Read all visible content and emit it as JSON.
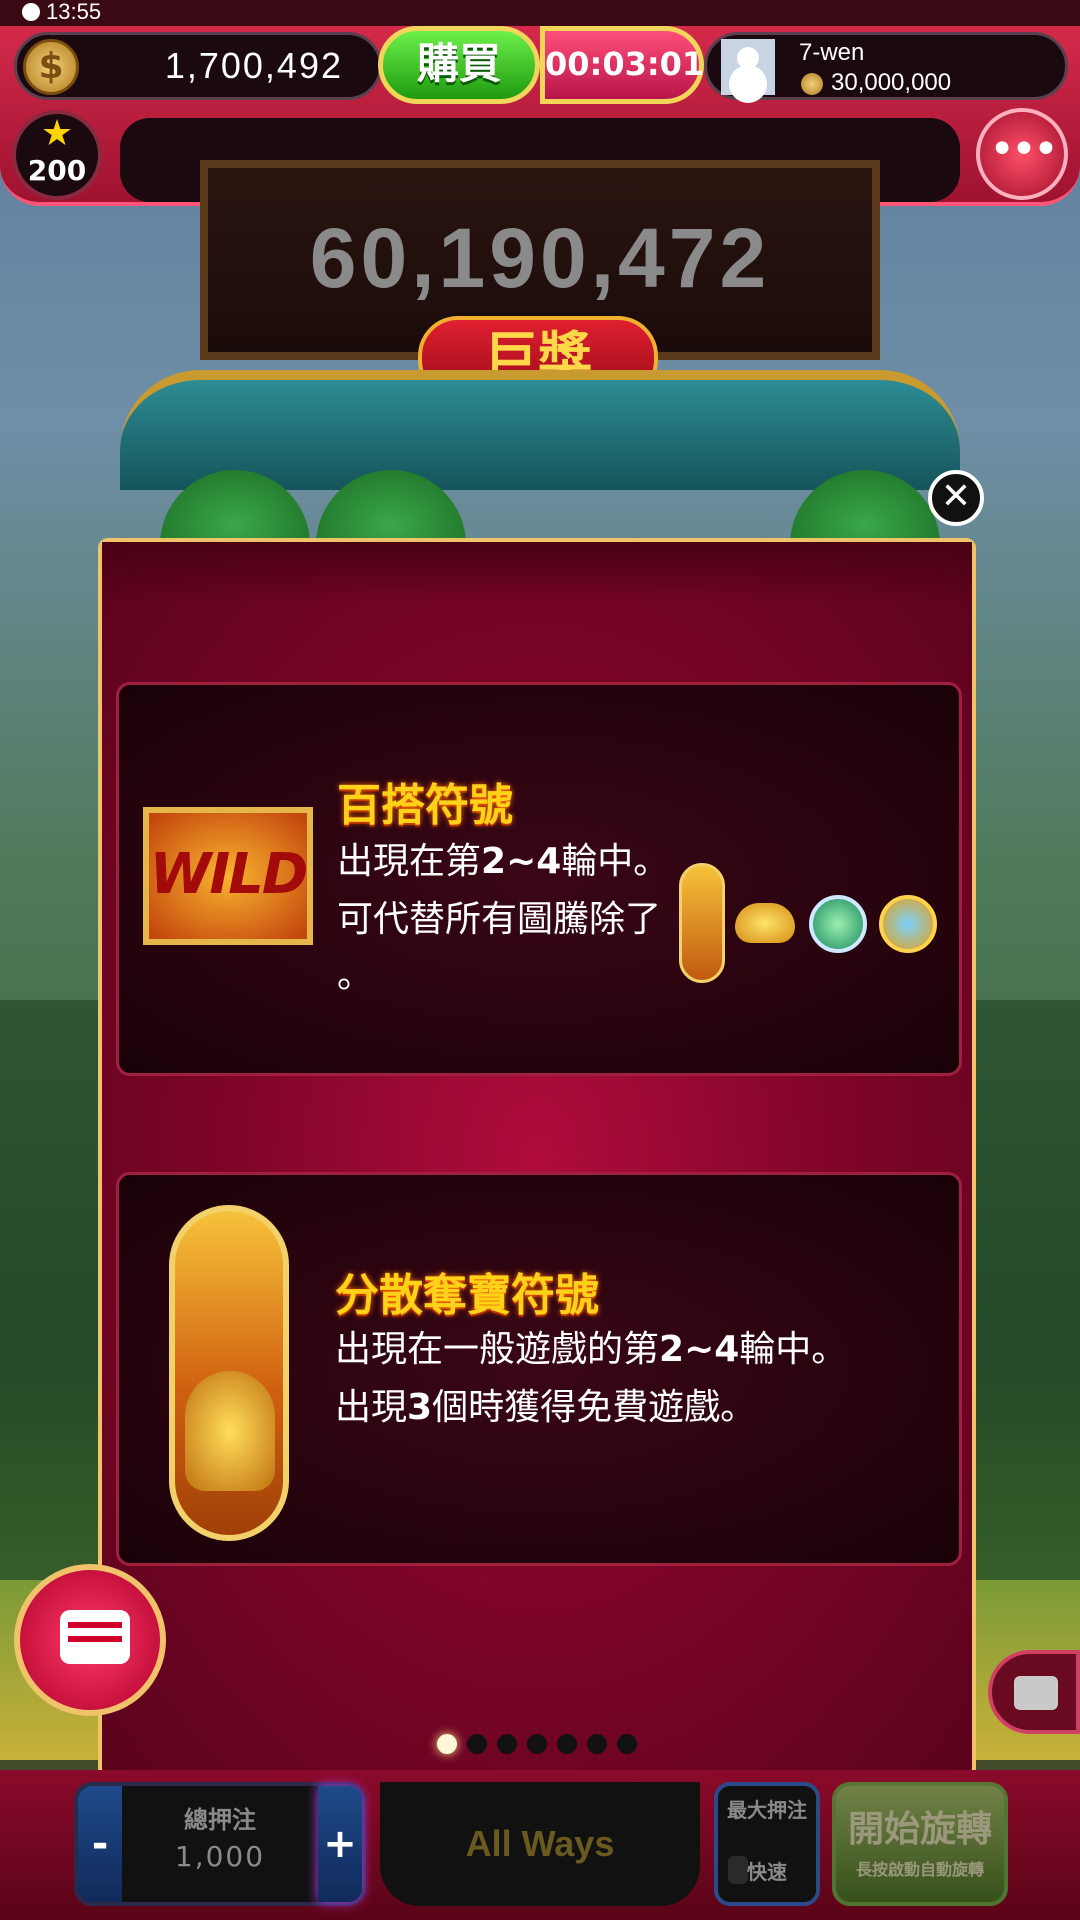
{
  "status_bar": {
    "time": "13:55"
  },
  "header": {
    "coin_icon": "dollar-coin-icon",
    "coin_balance": "1,700,492",
    "buy_label": "購買",
    "timer": "00:03:01",
    "user_name": "7-wen",
    "user_coins": "30,000,000",
    "level": "200",
    "more_label": "•••"
  },
  "jackpot": {
    "value": "60,190,472",
    "label": "巨獎"
  },
  "modal": {
    "close_label": "✕",
    "cards": [
      {
        "title": "百搭符號",
        "symbol_label": "WILD",
        "line1_pre": "出現在第",
        "line1_bold": "2~4",
        "line1_post": "輪中。",
        "line2": "可代替所有圖騰除了",
        "line3": "。"
      },
      {
        "title": "分散奪寶符號",
        "line1_pre": "出現在一般遊戲的第",
        "line1_bold": "2~4",
        "line1_post": "輪中。",
        "line2_pre": "出現",
        "line2_bold": "3",
        "line2_post": "個時獲得免費遊戲。"
      }
    ],
    "page_count": 7,
    "active_page": 1
  },
  "controls": {
    "total_bet_label": "總押注",
    "total_bet_value": "1,000",
    "minus_label": "-",
    "plus_label": "+",
    "ways_label": "All Ways",
    "max_bet_label": "最大押注",
    "fast_label": "快速",
    "spin_label": "開始旋轉",
    "spin_sub_label": "長按啟動自動旋轉"
  }
}
